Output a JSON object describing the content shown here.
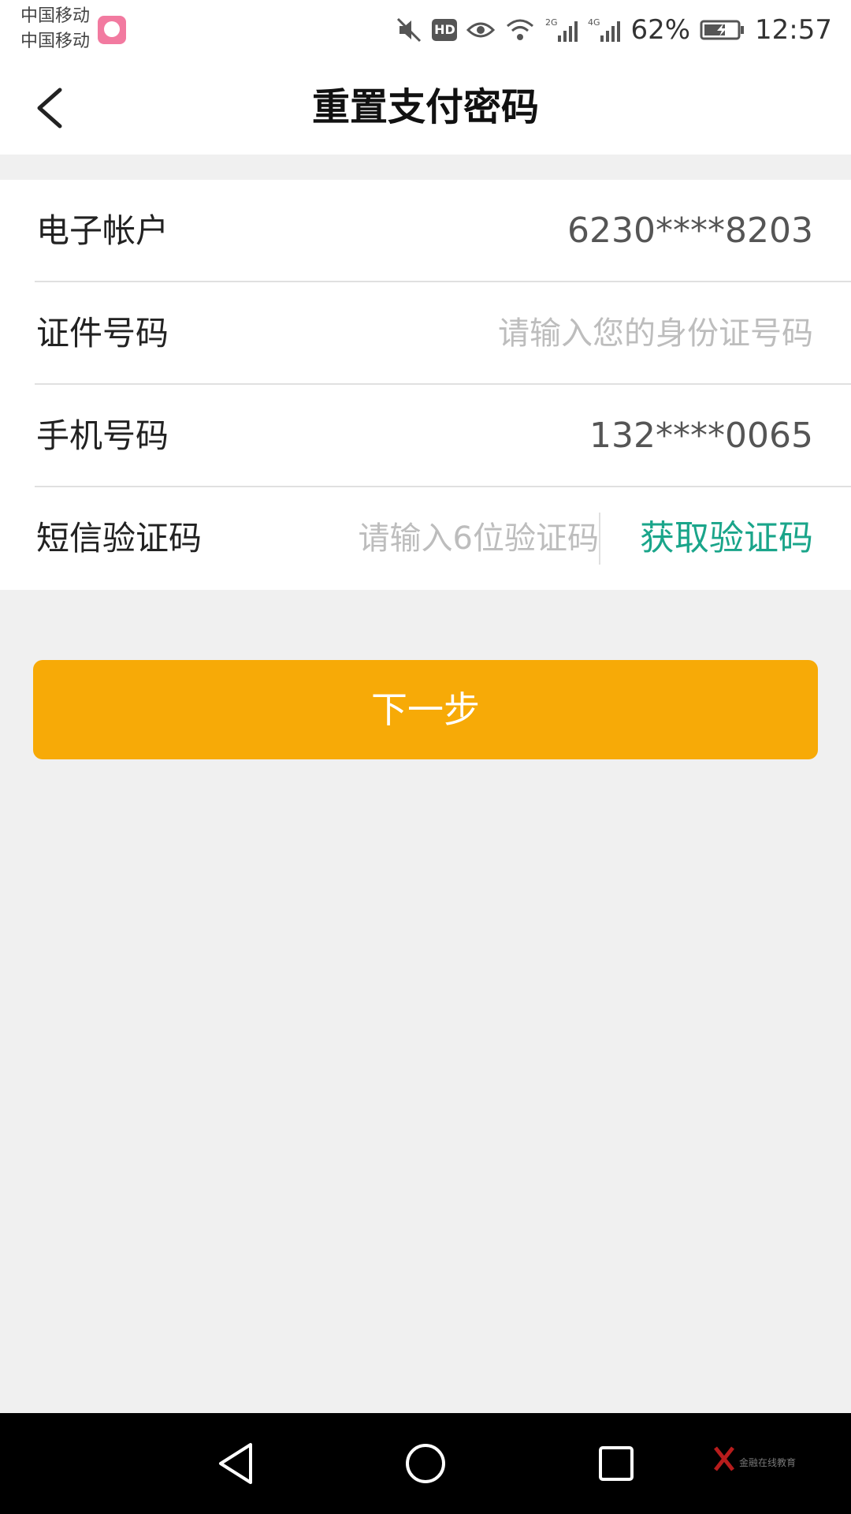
{
  "status_bar": {
    "carrier_1": "中国移动",
    "carrier_2": "中国移动",
    "battery": "62%",
    "time": "12:57",
    "hd_label": "HD",
    "icons": [
      "mute-icon",
      "hd-icon",
      "eye-icon",
      "wifi-icon",
      "signal-2g-icon",
      "signal-4g-icon",
      "battery-charging-icon"
    ]
  },
  "header": {
    "title": "重置支付密码",
    "back_icon": "chevron-left-icon"
  },
  "form": {
    "account": {
      "label": "电子帐户",
      "value": "6230****8203"
    },
    "id_number": {
      "label": "证件号码",
      "placeholder": "请输入您的身份证号码"
    },
    "phone": {
      "label": "手机号码",
      "value": "132****0065"
    },
    "sms_code": {
      "label": "短信验证码",
      "placeholder": "请输入6位验证码",
      "action": "获取验证码"
    }
  },
  "next_button": {
    "label": "下一步"
  },
  "nav_bar": {
    "icons": [
      "nav-back-icon",
      "nav-home-icon",
      "nav-recent-icon"
    ]
  },
  "watermark": {
    "text": "金融在线教育"
  },
  "colors": {
    "accent": "#f7aa07",
    "link_green": "#1aa58a",
    "background": "#f0f0f0"
  }
}
